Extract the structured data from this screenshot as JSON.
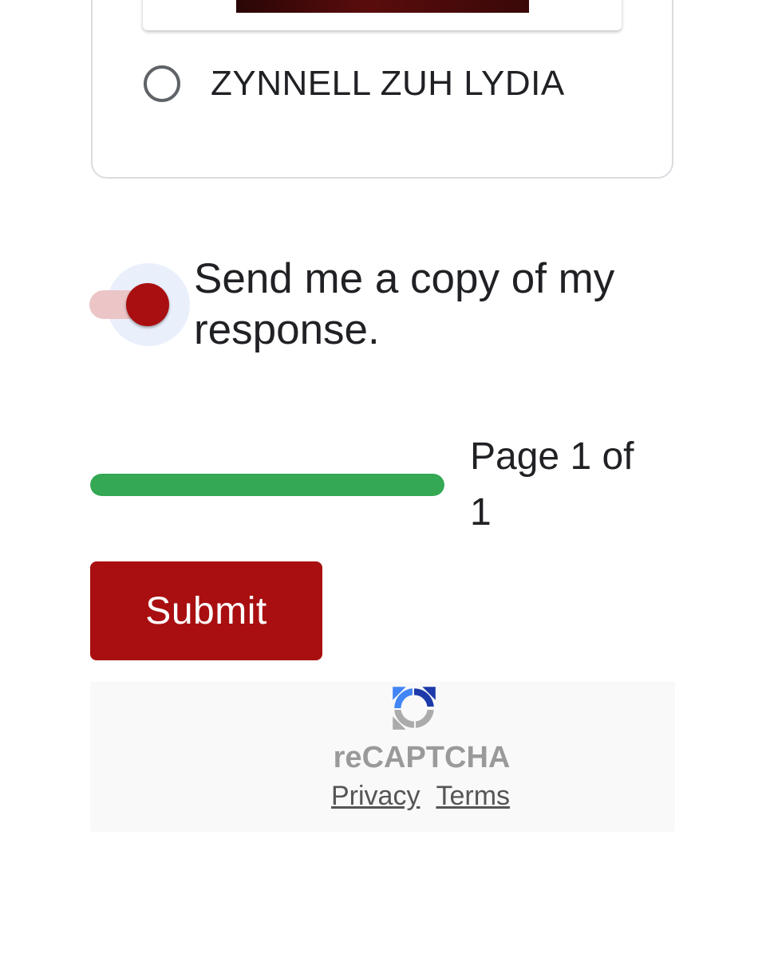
{
  "question": {
    "option_label": "ZYNNELL ZUH LYDIA",
    "option_selected": false
  },
  "send_copy": {
    "label": "Send me a copy of my response.",
    "enabled": true
  },
  "progress": {
    "text": "Page 1 of 1",
    "fraction": 1.0,
    "color": "#34a853"
  },
  "submit": {
    "label": "Submit",
    "color": "#a90f10"
  },
  "recaptcha": {
    "title": "reCAPTCHA",
    "privacy_label": "Privacy",
    "terms_label": "Terms",
    "icon": "recaptcha-logo-icon"
  }
}
